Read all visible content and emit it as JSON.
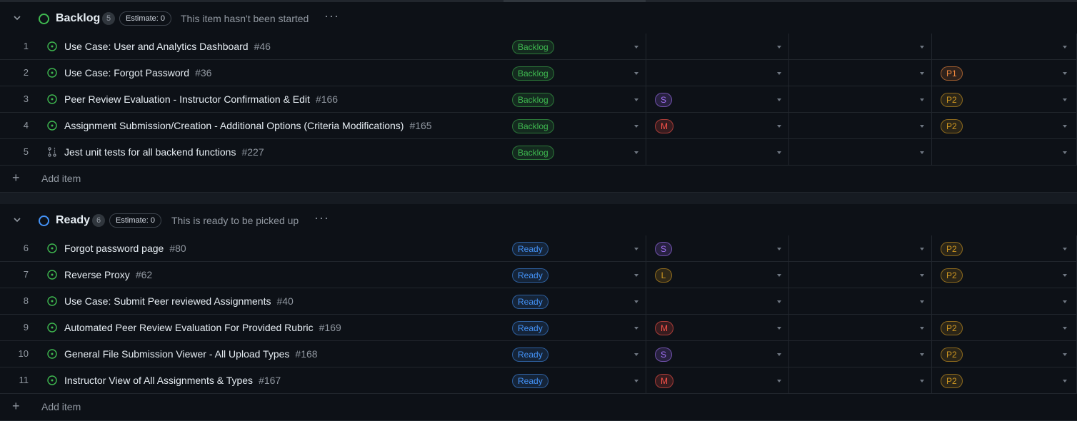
{
  "groups": [
    {
      "title": "Backlog",
      "count": "5",
      "estimate": "Estimate: 0",
      "description": "This item hasn't been started",
      "color": "#3fb950",
      "items": [
        {
          "n": "1",
          "title": "Use Case: User and Analytics Dashboard",
          "num": "#46",
          "icon": "issue-open-icon",
          "status": "Backlog",
          "size": "",
          "priority": ""
        },
        {
          "n": "2",
          "title": "Use Case: Forgot Password",
          "num": "#36",
          "icon": "issue-open-icon",
          "status": "Backlog",
          "size": "",
          "priority": "P1"
        },
        {
          "n": "3",
          "title": "Peer Review Evaluation - Instructor Confirmation & Edit",
          "num": "#166",
          "icon": "issue-open-icon",
          "status": "Backlog",
          "size": "S",
          "priority": "P2"
        },
        {
          "n": "4",
          "title": "Assignment Submission/Creation - Additional Options (Criteria Modifications)",
          "num": "#165",
          "icon": "issue-open-icon",
          "status": "Backlog",
          "size": "M",
          "priority": "P2"
        },
        {
          "n": "5",
          "title": "Jest unit tests for all backend functions",
          "num": "#227",
          "icon": "pull-request-icon",
          "status": "Backlog",
          "size": "",
          "priority": ""
        }
      ],
      "add_label": "Add item"
    },
    {
      "title": "Ready",
      "count": "6",
      "estimate": "Estimate: 0",
      "description": "This is ready to be picked up",
      "color": "#4493f8",
      "items": [
        {
          "n": "6",
          "title": "Forgot password page",
          "num": "#80",
          "icon": "issue-open-icon",
          "status": "Ready",
          "size": "S",
          "priority": "P2"
        },
        {
          "n": "7",
          "title": "Reverse Proxy",
          "num": "#62",
          "icon": "issue-open-icon",
          "status": "Ready",
          "size": "L",
          "priority": "P2"
        },
        {
          "n": "8",
          "title": "Use Case: Submit Peer reviewed Assignments",
          "num": "#40",
          "icon": "issue-open-icon",
          "status": "Ready",
          "size": "",
          "priority": ""
        },
        {
          "n": "9",
          "title": "Automated Peer Review Evaluation For Provided Rubric",
          "num": "#169",
          "icon": "issue-open-icon",
          "status": "Ready",
          "size": "M",
          "priority": "P2"
        },
        {
          "n": "10",
          "title": "General File Submission Viewer - All Upload Types",
          "num": "#168",
          "icon": "issue-open-icon",
          "status": "Ready",
          "size": "S",
          "priority": "P2"
        },
        {
          "n": "11",
          "title": "Instructor View of All Assignments & Types",
          "num": "#167",
          "icon": "issue-open-icon",
          "status": "Ready",
          "size": "M",
          "priority": "P2"
        }
      ],
      "add_label": "Add item"
    }
  ],
  "colors": {
    "backlog_pill": "#3fb950",
    "ready_pill": "#4493f8",
    "size_S": "#a371f7",
    "size_M": "#f85149",
    "size_L": "#d29922",
    "P1": "#f0883e",
    "P2": "#d29922"
  },
  "more_label": "···"
}
